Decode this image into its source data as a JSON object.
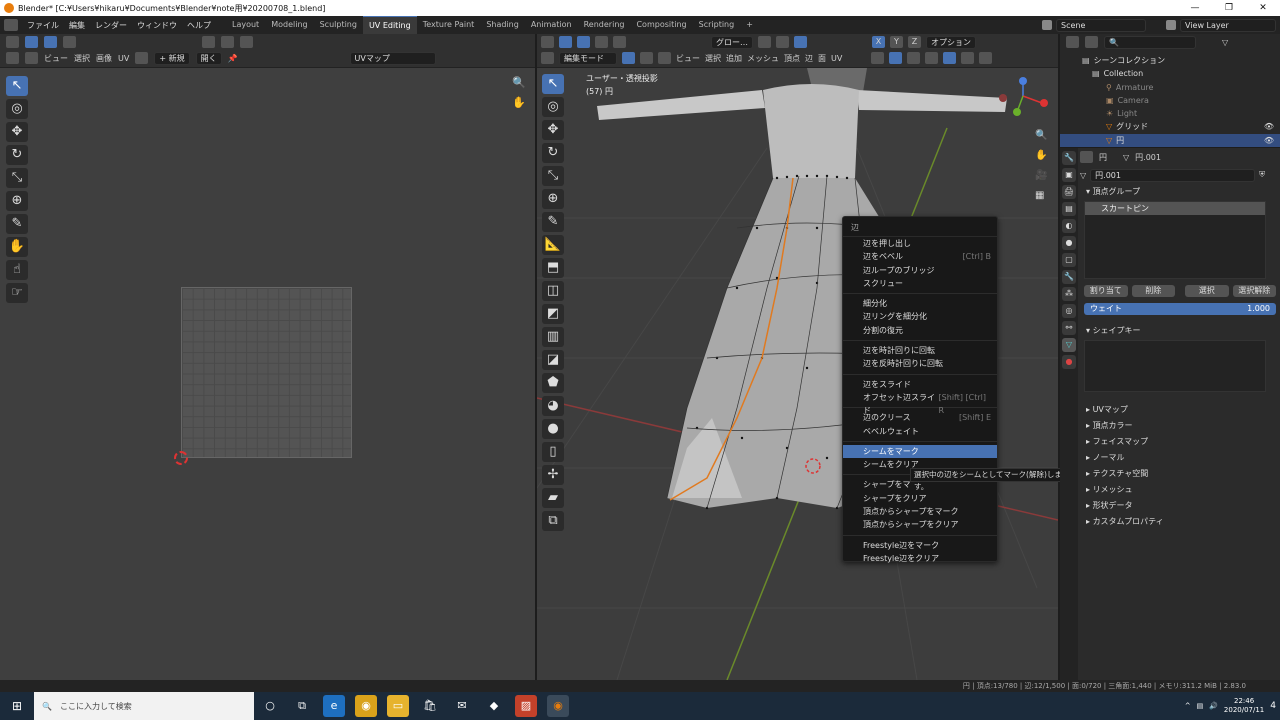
{
  "window": {
    "title": "Blender* [C:¥Users¥hikaru¥Documents¥Blender¥note用¥20200708_1.blend]",
    "controls": [
      "—",
      "❐",
      "✕"
    ]
  },
  "menubar": {
    "items": [
      "ファイル",
      "編集",
      "レンダー",
      "ウィンドウ",
      "ヘルプ"
    ],
    "workspaces": [
      "Layout",
      "Modeling",
      "Sculpting",
      "UV Editing",
      "Texture Paint",
      "Shading",
      "Animation",
      "Rendering",
      "Compositing",
      "Scripting",
      "+"
    ],
    "active_workspace": "UV Editing",
    "scene": "Scene",
    "view_layer": "View Layer"
  },
  "uv_editor": {
    "menus": [
      "ビュー",
      "選択",
      "画像",
      "UV"
    ],
    "new_label": "+ 新規",
    "open_label": "開く",
    "uv_map": "UVマップ"
  },
  "viewport": {
    "mode": "編集モード",
    "menus": [
      "ビュー",
      "選択",
      "追加",
      "メッシュ",
      "頂点",
      "辺",
      "面",
      "UV"
    ],
    "transform": "グロー…",
    "options": "オプション",
    "axes": [
      "X",
      "Y",
      "Z"
    ],
    "info_line1": "ユーザー・透視投影",
    "info_line2": "(57) 円"
  },
  "context_menu": {
    "title": "辺",
    "groups": [
      [
        {
          "label": "辺を押し出し",
          "shortcut": ""
        },
        {
          "label": "辺をベベル",
          "shortcut": "[Ctrl] B"
        },
        {
          "label": "辺ループのブリッジ",
          "shortcut": ""
        },
        {
          "label": "スクリュー",
          "shortcut": ""
        }
      ],
      [
        {
          "label": "細分化",
          "shortcut": ""
        },
        {
          "label": "辺リングを細分化",
          "shortcut": ""
        },
        {
          "label": "分割の復元",
          "shortcut": ""
        }
      ],
      [
        {
          "label": "辺を時計回りに回転",
          "shortcut": ""
        },
        {
          "label": "辺を反時計回りに回転",
          "shortcut": ""
        }
      ],
      [
        {
          "label": "辺をスライド",
          "shortcut": ""
        },
        {
          "label": "オフセット辺スライド",
          "shortcut": "[Shift] [Ctrl] R"
        }
      ],
      [
        {
          "label": "辺のクリース",
          "shortcut": "[Shift] E"
        },
        {
          "label": "ベベルウェイト",
          "shortcut": ""
        }
      ],
      [
        {
          "label": "シームをマーク",
          "shortcut": "",
          "highlight": true
        },
        {
          "label": "シームをクリア",
          "shortcut": ""
        }
      ],
      [
        {
          "label": "シャープをマ",
          "shortcut": ""
        },
        {
          "label": "シャープをクリア",
          "shortcut": ""
        },
        {
          "label": "頂点からシャープをマーク",
          "shortcut": ""
        },
        {
          "label": "頂点からシャープをクリア",
          "shortcut": ""
        }
      ],
      [
        {
          "label": "Freestyle辺をマーク",
          "shortcut": ""
        },
        {
          "label": "Freestyle辺をクリア",
          "shortcut": ""
        }
      ]
    ],
    "tooltip": "選択中の辺をシームとしてマーク(解除)します。"
  },
  "outliner": {
    "root": "シーンコレクション",
    "collection": "Collection",
    "items": [
      {
        "label": "Armature",
        "dim": true
      },
      {
        "label": "Camera",
        "dim": true
      },
      {
        "label": "Light",
        "dim": true
      },
      {
        "label": "グリッド",
        "dim": false
      },
      {
        "label": "円",
        "dim": false,
        "selected": true
      }
    ]
  },
  "properties": {
    "object_name": "円",
    "mesh_name": "円.001",
    "mesh_field": "円.001",
    "vertex_groups_title": "頂点グループ",
    "vertex_group_item": "スカートピン",
    "buttons": [
      "割り当て",
      "削除",
      "選択",
      "選択解除"
    ],
    "weight_label": "ウェイト",
    "weight_value": "1.000",
    "shape_keys_title": "シェイプキー",
    "collapsed_panels": [
      "UVマップ",
      "頂点カラー",
      "フェイスマップ",
      "ノーマル",
      "テクスチャ空間",
      "リメッシュ",
      "形状データ",
      "カスタムプロパティ"
    ]
  },
  "statusbar": {
    "stats": "円 | 頂点:13/780 | 辺:12/1,500 | 面:0/720 | 三角面:1,440 | メモリ:311.2 MiB | 2.83.0"
  },
  "taskbar": {
    "search_placeholder": "ここに入力して検索",
    "time": "22:46",
    "date": "2020/07/11",
    "notification_count": "4"
  },
  "colors": {
    "accent": "#4772b3",
    "blender_orange": "#e87d0d",
    "seam": "#e07a20"
  }
}
